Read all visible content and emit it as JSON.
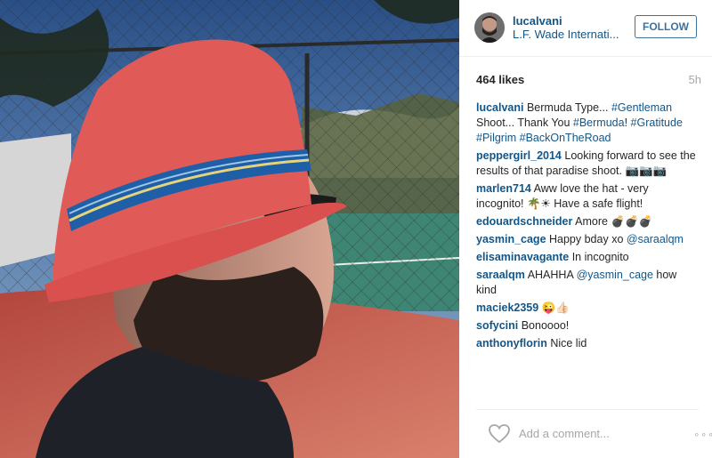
{
  "header": {
    "username": "lucalvani",
    "location": "L.F. Wade Internati...",
    "follow_label": "FOLLOW"
  },
  "meta": {
    "likes": "464 likes",
    "time": "5h"
  },
  "caption": {
    "user": "lucalvani",
    "text1": " Bermuda Type... ",
    "tag1": "#Gentleman",
    "text2": " Shoot... Thank You ",
    "tag2": "#Bermuda",
    "text3": "! ",
    "tag3": "#Gratitude",
    "tag4": "#Pilgrim",
    "tag5": "#BackOnTheRoad"
  },
  "comments": [
    {
      "user": "peppergirl_2014",
      "text": " Looking forward to see the results of that paradise shoot. 📷📷📷"
    },
    {
      "user": "marlen714",
      "text": " Aww love the hat - very incognito! 🌴☀ Have a safe flight!"
    },
    {
      "user": "edouardschneider",
      "text": " Amore 💣💣💣"
    },
    {
      "user": "yasmin_cage",
      "text": " Happy bday xo ",
      "tag": "@saraalqm"
    },
    {
      "user": "elisaminavagante",
      "text": " In incognito"
    },
    {
      "user": "saraalqm",
      "text": " AHAHHA ",
      "tag": "@yasmin_cage",
      "text_after": " how kind"
    },
    {
      "user": "maciek2359",
      "text": " 😜👍🏻"
    },
    {
      "user": "sofycini",
      "text": " Bonoooo!"
    },
    {
      "user": "anthonyflorin",
      "text": " Nice lid"
    }
  ],
  "footer": {
    "add_comment_placeholder": "Add a comment...",
    "more": "∘∘∘"
  },
  "icons": {
    "heart": "heart-icon",
    "more": "more-options-icon"
  },
  "colors": {
    "username": "#125688",
    "follow": "#3f729b",
    "muted": "#a5a7aa",
    "hat": "#e05a58"
  }
}
